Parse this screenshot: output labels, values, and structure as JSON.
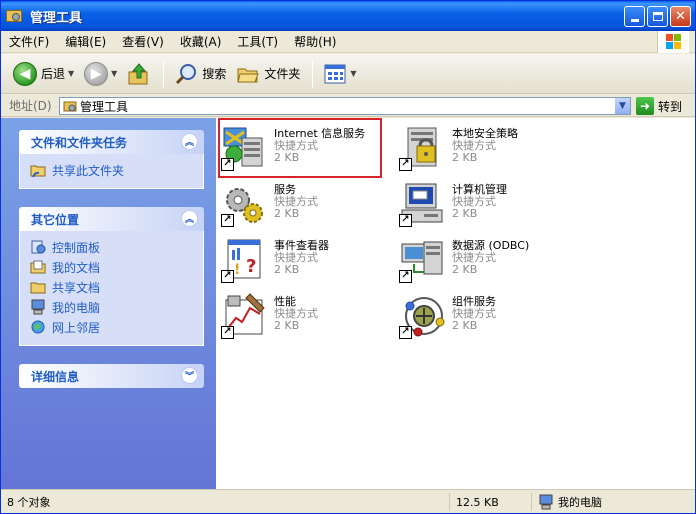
{
  "window": {
    "title": "管理工具",
    "controls": [
      "minimize-icon",
      "maximize-icon",
      "close-icon"
    ]
  },
  "menubar": {
    "items": [
      "文件(F)",
      "编辑(E)",
      "查看(V)",
      "收藏(A)",
      "工具(T)",
      "帮助(H)"
    ]
  },
  "toolbar": {
    "back_label": "后退",
    "search_label": "搜索",
    "folders_label": "文件夹"
  },
  "address": {
    "label": "地址(D)",
    "value": "管理工具",
    "go_label": "转到"
  },
  "sidebar": {
    "panels": [
      {
        "title": "文件和文件夹任务",
        "items": [
          "共享此文件夹"
        ]
      },
      {
        "title": "其它位置",
        "items": [
          "控制面板",
          "我的文档",
          "共享文档",
          "我的电脑",
          "网上邻居"
        ]
      },
      {
        "title": "详细信息",
        "items": []
      }
    ]
  },
  "files": [
    {
      "name": "Internet 信息服务",
      "type": "快捷方式",
      "size": "2 KB"
    },
    {
      "name": "本地安全策略",
      "type": "快捷方式",
      "size": "2 KB"
    },
    {
      "name": "服务",
      "type": "快捷方式",
      "size": "2 KB"
    },
    {
      "name": "计算机管理",
      "type": "快捷方式",
      "size": "2 KB"
    },
    {
      "name": "事件查看器",
      "type": "快捷方式",
      "size": "2 KB"
    },
    {
      "name": "数据源 (ODBC)",
      "type": "快捷方式",
      "size": "2 KB"
    },
    {
      "name": "性能",
      "type": "快捷方式",
      "size": "2 KB"
    },
    {
      "name": "组件服务",
      "type": "快捷方式",
      "size": "2 KB"
    }
  ],
  "statusbar": {
    "count": "8 个对象",
    "size": "12.5 KB",
    "location": "我的电脑"
  },
  "colors": {
    "titlebar": "#0553dc",
    "sidebar_link": "#215dc6",
    "highlight": "#d9232b"
  }
}
